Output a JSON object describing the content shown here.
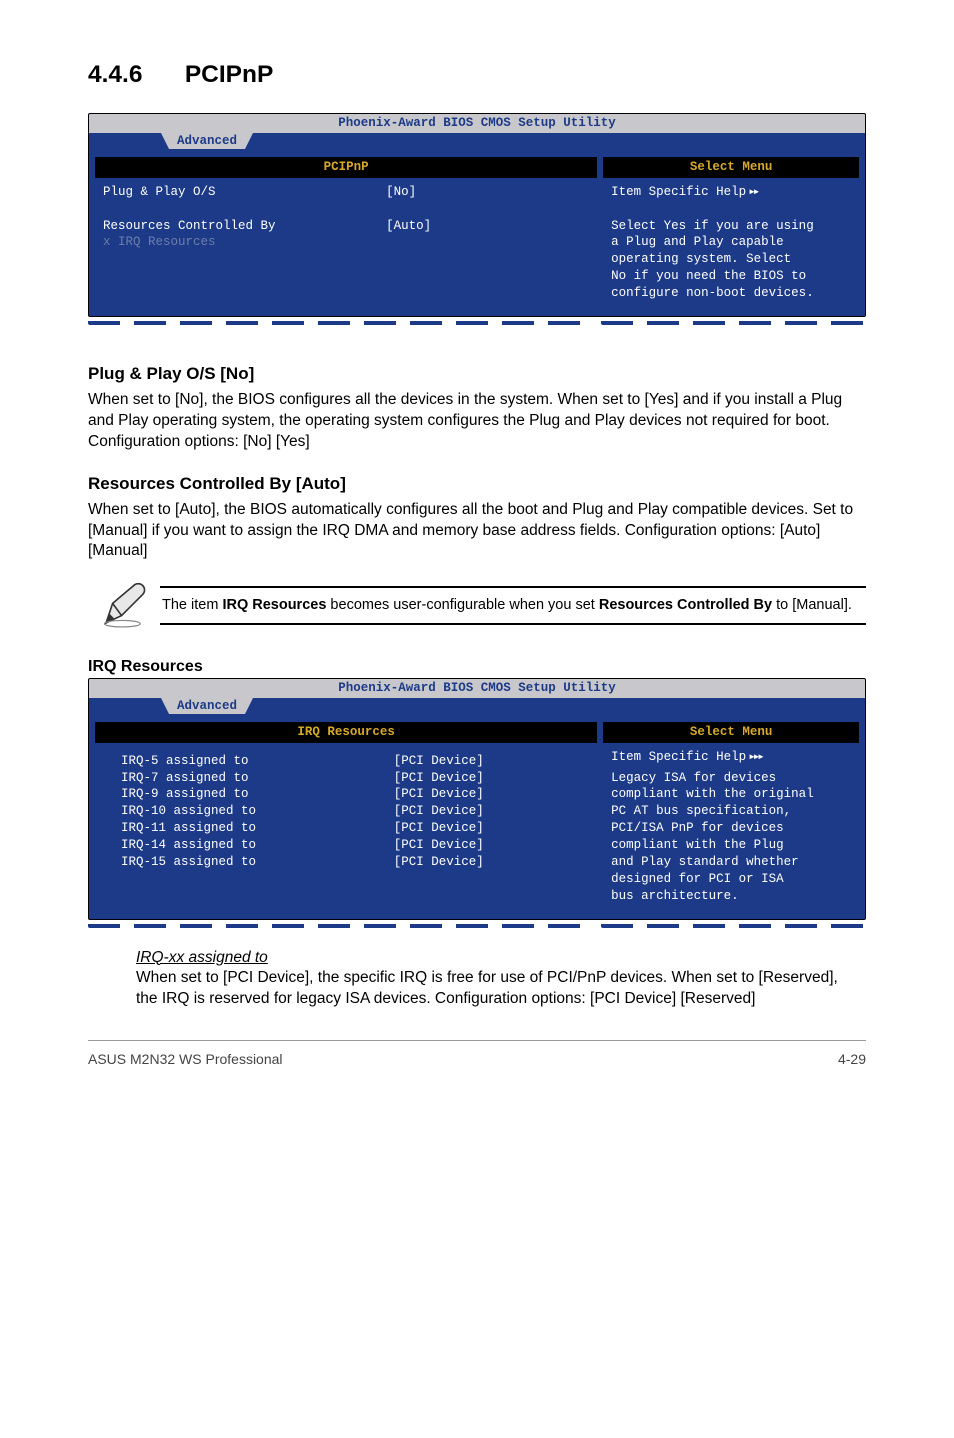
{
  "section": {
    "number": "4.4.6",
    "title": "PCIPnP"
  },
  "bios1": {
    "utility_title": "Phoenix-Award BIOS CMOS Setup Utility",
    "tab": "Advanced",
    "left_header": "PCIPnP",
    "right_header": "Select Menu",
    "rows": [
      {
        "k": "Plug & Play O/S",
        "v": "[No]",
        "dim": false
      },
      {
        "k": "",
        "v": "",
        "dim": false
      },
      {
        "k": "Resources Controlled By",
        "v": "[Auto]",
        "dim": false
      },
      {
        "k": "x  IRQ Resources",
        "v": "",
        "dim": true
      }
    ],
    "help_title": "Item Specific Help",
    "help_lines": [
      "Select Yes if you are using",
      "a Plug and Play capable",
      "operating system. Select",
      "No if you need the BIOS to",
      "configure non-boot devices."
    ]
  },
  "subs": {
    "pp_title": "Plug & Play O/S [No]",
    "pp_body": "When set to [No], the BIOS configures all the devices in the system. When set to [Yes] and if you install a Plug and Play operating system, the operating system configures the Plug and Play devices not required for boot. Configuration options: [No] [Yes]",
    "rcb_title": "Resources Controlled By [Auto]",
    "rcb_body": "When set to [Auto], the BIOS automatically configures all the boot and Plug and Play compatible devices. Set to [Manual] if you want to assign the IRQ DMA and memory base address fields. Configuration options: [Auto] [Manual]"
  },
  "note": {
    "pre": "The item ",
    "b1": "IRQ Resources",
    "mid": " becomes user-configurable when you set ",
    "b2": "Resources Controlled By",
    "post": " to [Manual]."
  },
  "irq_heading": "IRQ Resources",
  "bios2": {
    "utility_title": "Phoenix-Award BIOS CMOS Setup Utility",
    "tab": "Advanced",
    "left_header": "IRQ Resources",
    "right_header": "Select Menu",
    "rows": [
      {
        "k": "IRQ-5 assigned to",
        "v": "[PCI Device]"
      },
      {
        "k": "IRQ-7 assigned to",
        "v": "[PCI Device]"
      },
      {
        "k": "IRQ-9 assigned to",
        "v": "[PCI Device]"
      },
      {
        "k": "IRQ-10 assigned to",
        "v": "[PCI Device]"
      },
      {
        "k": "IRQ-11 assigned to",
        "v": "[PCI Device]"
      },
      {
        "k": "IRQ-14 assigned to",
        "v": "[PCI Device]"
      },
      {
        "k": "IRQ-15 assigned to",
        "v": "[PCI Device]"
      }
    ],
    "help_title": "Item Specific Help",
    "help_lines": [
      "Legacy ISA for devices",
      "compliant with the original",
      "PC AT bus specification,",
      "PCI/ISA PnP for devices",
      "compliant with the Plug",
      "and Play standard whether",
      "designed for PCI or ISA",
      "bus architecture."
    ]
  },
  "irq_sub": {
    "title": "IRQ-xx assigned to",
    "body": "When set to [PCI Device], the specific IRQ is free for use of PCI/PnP devices. When set to [Reserved], the IRQ is reserved for legacy ISA devices. Configuration options: [PCI Device] [Reserved]"
  },
  "footer": {
    "left": "ASUS M2N32 WS Professional",
    "right": "4-29"
  }
}
